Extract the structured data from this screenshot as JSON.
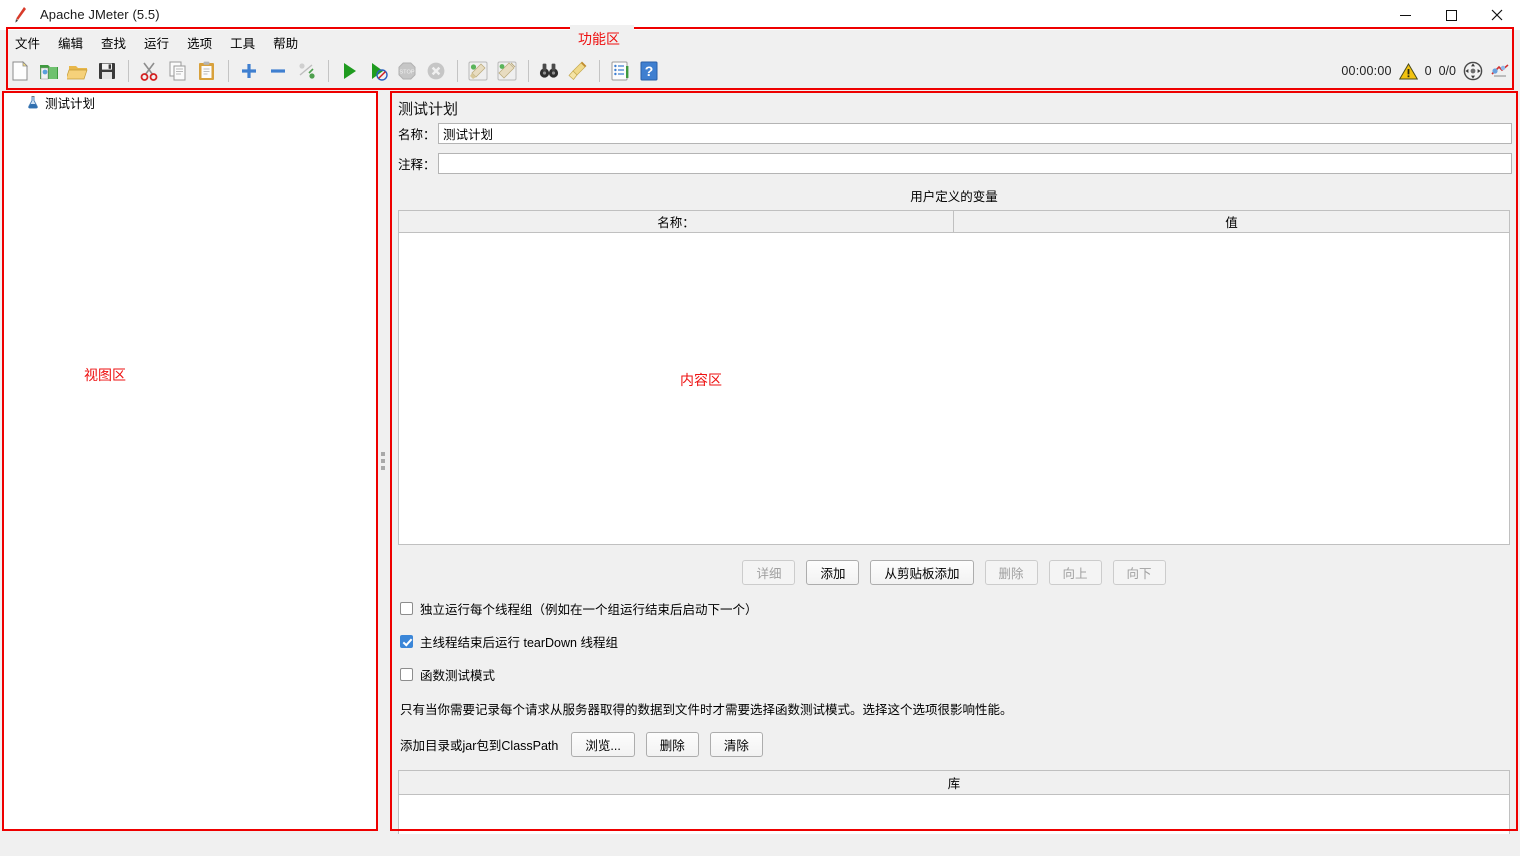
{
  "window": {
    "title": "Apache JMeter (5.5)",
    "app_icon": "jmeter-feather-icon",
    "minimize": "−",
    "maximize": "□",
    "close": "✕"
  },
  "menubar": {
    "items": [
      {
        "label": "文件",
        "name": "menu-file"
      },
      {
        "label": "编辑",
        "name": "menu-edit"
      },
      {
        "label": "查找",
        "name": "menu-search"
      },
      {
        "label": "运行",
        "name": "menu-run"
      },
      {
        "label": "选项",
        "name": "menu-options"
      },
      {
        "label": "工具",
        "name": "menu-tools"
      },
      {
        "label": "帮助",
        "name": "menu-help"
      }
    ]
  },
  "toolbar": {
    "buttons": [
      {
        "name": "new-icon",
        "title": "新建"
      },
      {
        "name": "templates-icon",
        "title": "模板"
      },
      {
        "name": "open-icon",
        "title": "打开"
      },
      {
        "name": "save-icon",
        "title": "保存"
      },
      {
        "name": "cut-icon",
        "title": "剪切"
      },
      {
        "name": "copy-icon",
        "title": "复制"
      },
      {
        "name": "paste-icon",
        "title": "粘贴"
      },
      {
        "name": "expand-all-icon",
        "title": "展开"
      },
      {
        "name": "collapse-all-icon",
        "title": "收起"
      },
      {
        "name": "toggle-icon",
        "title": "切换"
      },
      {
        "name": "start-icon",
        "title": "启动"
      },
      {
        "name": "start-no-pause-icon",
        "title": "启动无暂停"
      },
      {
        "name": "stop-icon",
        "title": "停止"
      },
      {
        "name": "shutdown-icon",
        "title": "关闭"
      },
      {
        "name": "clear-icon",
        "title": "清除"
      },
      {
        "name": "clear-all-icon",
        "title": "清除全部"
      },
      {
        "name": "search-icon",
        "title": "搜索"
      },
      {
        "name": "reset-search-icon",
        "title": "重置搜索"
      },
      {
        "name": "function-helper-icon",
        "title": "函数助手"
      },
      {
        "name": "help-icon",
        "title": "帮助"
      }
    ],
    "status": {
      "elapsed": "00:00:00",
      "warning_icon": "warning-triangle-icon",
      "error_count": "0",
      "threads": "0/0",
      "remote_icon": "remote-engines-icon",
      "connect_icon": "remote-connect-icon"
    }
  },
  "annotations": {
    "function_area": "功能区",
    "view_area": "视图区",
    "content_area": "内容区",
    "color": "#ee0000"
  },
  "tree": {
    "nodes": [
      {
        "label": "测试计划",
        "icon": "test-plan-beaker-icon",
        "selected": true
      }
    ]
  },
  "content": {
    "panel_title": "测试计划",
    "name_label": "名称：",
    "name_value": "测试计划",
    "comment_label": "注释：",
    "comment_value": "",
    "udv_title": "用户定义的变量",
    "udv_columns": [
      "名称：",
      "值"
    ],
    "udv_rows": [],
    "buttons": [
      {
        "label": "详细",
        "name": "detail-button",
        "disabled": true
      },
      {
        "label": "添加",
        "name": "add-button",
        "disabled": false
      },
      {
        "label": "从剪贴板添加",
        "name": "add-from-clipboard-button",
        "disabled": false
      },
      {
        "label": "删除",
        "name": "delete-button",
        "disabled": true
      },
      {
        "label": "向上",
        "name": "move-up-button",
        "disabled": true
      },
      {
        "label": "向下",
        "name": "move-down-button",
        "disabled": true
      }
    ],
    "checkboxes": [
      {
        "label": "独立运行每个线程组（例如在一个组运行结束后启动下一个）",
        "name": "serialize-thread-groups-checkbox",
        "checked": false
      },
      {
        "label": "主线程结束后运行 tearDown 线程组",
        "name": "run-teardown-checkbox",
        "checked": true
      },
      {
        "label": "函数测试模式",
        "name": "functional-test-mode-checkbox",
        "checked": false
      }
    ],
    "note": "只有当你需要记录每个请求从服务器取得的数据到文件时才需要选择函数测试模式。选择这个选项很影响性能。",
    "classpath_label": "添加目录或jar包到ClassPath",
    "classpath_buttons": [
      {
        "label": "浏览...",
        "name": "browse-button"
      },
      {
        "label": "删除",
        "name": "classpath-delete-button"
      },
      {
        "label": "清除",
        "name": "classpath-clear-button"
      }
    ],
    "library_header": "库",
    "library_rows": []
  }
}
